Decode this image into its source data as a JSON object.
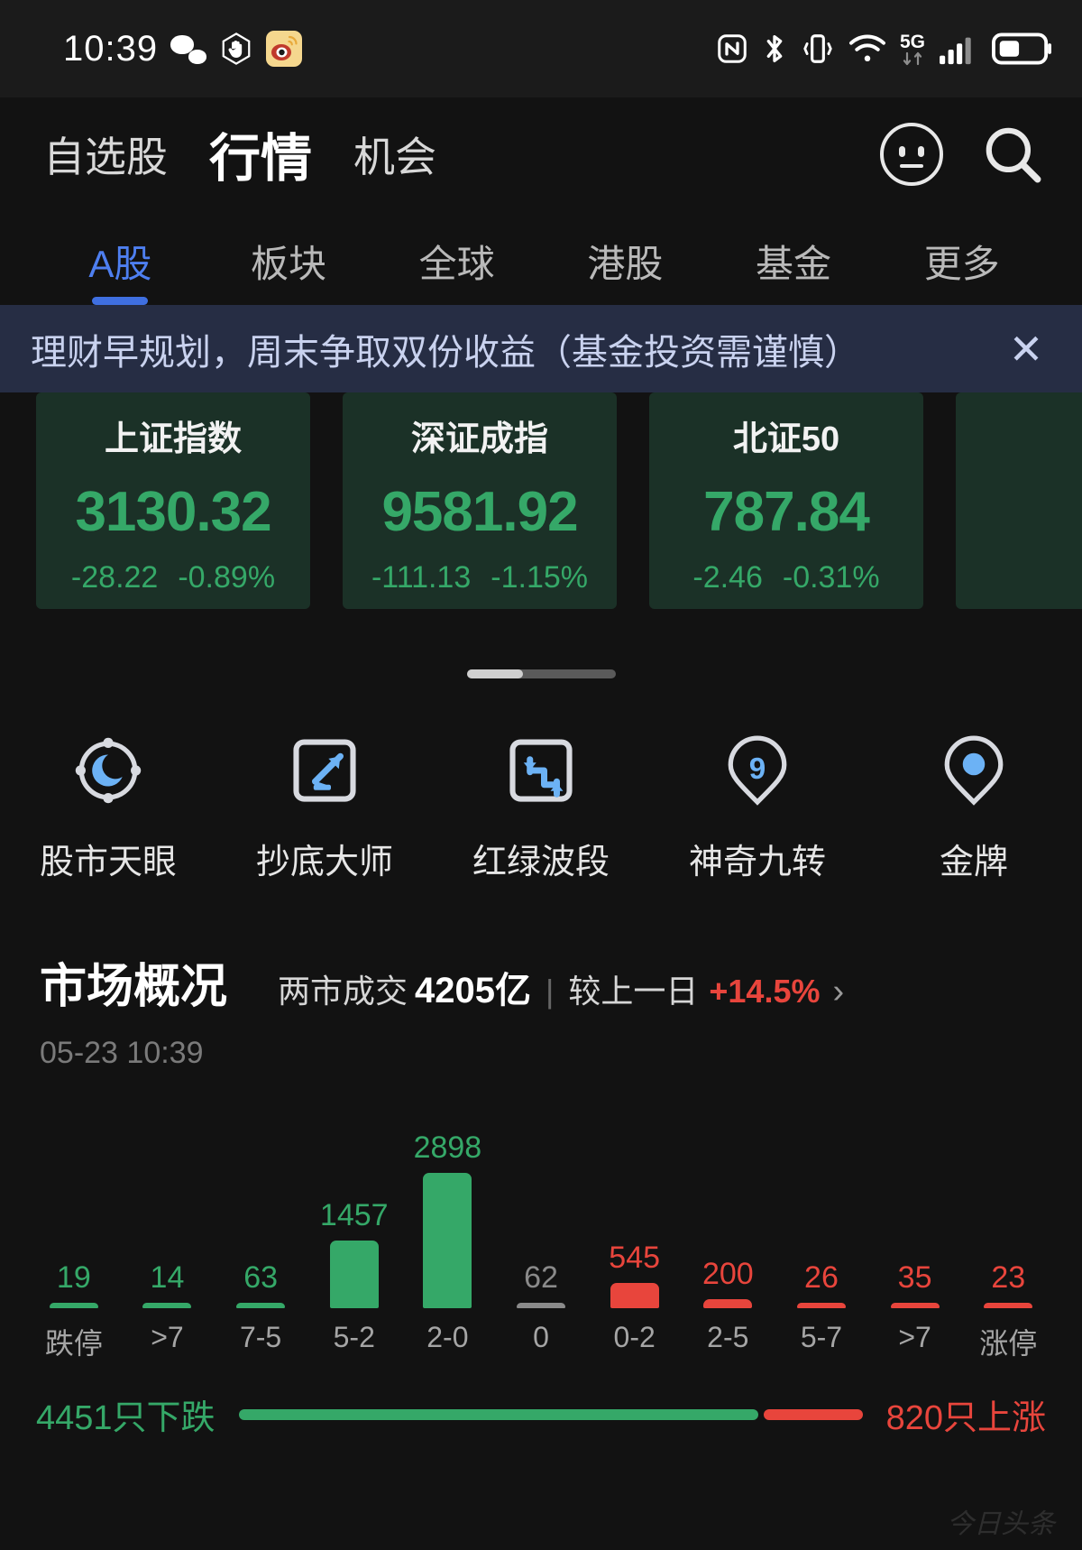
{
  "status_bar": {
    "time": "10:39",
    "left_icons": [
      "wechat-icon",
      "hand-icon",
      "weibo-icon"
    ],
    "right_icons": [
      "nfc-icon",
      "bluetooth-icon",
      "vibrate-icon",
      "wifi-icon",
      "signal-icon",
      "battery-icon"
    ],
    "network_label": "5G"
  },
  "top_nav": {
    "items": [
      {
        "label": "自选股",
        "active": false
      },
      {
        "label": "行情",
        "active": true
      },
      {
        "label": "机会",
        "active": false
      }
    ],
    "icons": [
      "emoji-face-icon",
      "search-icon"
    ]
  },
  "tabs": {
    "items": [
      {
        "label": "A股",
        "active": true
      },
      {
        "label": "板块",
        "active": false
      },
      {
        "label": "全球",
        "active": false
      },
      {
        "label": "港股",
        "active": false
      },
      {
        "label": "基金",
        "active": false
      },
      {
        "label": "更多",
        "active": false
      }
    ],
    "active_color": "#4e7ff0"
  },
  "banner": {
    "text": "理财早规划，周末争取双份收益（基金投资需谨慎）",
    "close_label": "✕",
    "background": "#262d44",
    "text_color": "#c9d2ef"
  },
  "index_cards": [
    {
      "name": "上证指数",
      "value": "3130.32",
      "change": "-28.22",
      "percent": "-0.89%"
    },
    {
      "name": "深证成指",
      "value": "9581.92",
      "change": "-111.13",
      "percent": "-1.15%"
    },
    {
      "name": "北证50",
      "value": "787.84",
      "change": "-2.46",
      "percent": "-0.31%"
    },
    {
      "name": "",
      "value": "",
      "change": "",
      "percent": ""
    }
  ],
  "down_color": "#35a868",
  "up_color": "#e8453c",
  "functions": [
    {
      "label": "股市天眼",
      "icon": "compass-eye-icon"
    },
    {
      "label": "抄底大师",
      "icon": "down-arrow-box-icon"
    },
    {
      "label": "红绿波段",
      "icon": "zigzag-arrow-box-icon"
    },
    {
      "label": "神奇九转",
      "icon": "nine-pin-icon"
    },
    {
      "label": "金牌",
      "icon": "medal-pin-icon"
    }
  ],
  "market_overview": {
    "title": "市场概况",
    "turnover_label": "两市成交",
    "turnover_value": "4205亿",
    "compare_label": "较上一日",
    "compare_value": "+14.5%",
    "chevron": "›",
    "timestamp": "05-23 10:39"
  },
  "chart_data": {
    "type": "bar",
    "title": "市场概况",
    "categories": [
      "跌停",
      ">7",
      "7-5",
      "5-2",
      "2-0",
      "0",
      "0-2",
      "2-5",
      "5-7",
      ">7",
      "涨停"
    ],
    "values": [
      19,
      14,
      63,
      1457,
      2898,
      62,
      545,
      200,
      26,
      35,
      23
    ],
    "colors": [
      "#35a868",
      "#35a868",
      "#35a868",
      "#35a868",
      "#35a868",
      "#8a8a8a",
      "#e8453c",
      "#e8453c",
      "#e8453c",
      "#e8453c",
      "#e8453c"
    ],
    "xlabel": "",
    "ylabel": "",
    "ylim": [
      0,
      2898
    ],
    "grid": false,
    "legend": "none"
  },
  "summary": {
    "down_text": "4451只下跌",
    "up_text": "820只上涨",
    "down_ratio": 84,
    "up_ratio": 16
  },
  "watermark": "今日头条"
}
